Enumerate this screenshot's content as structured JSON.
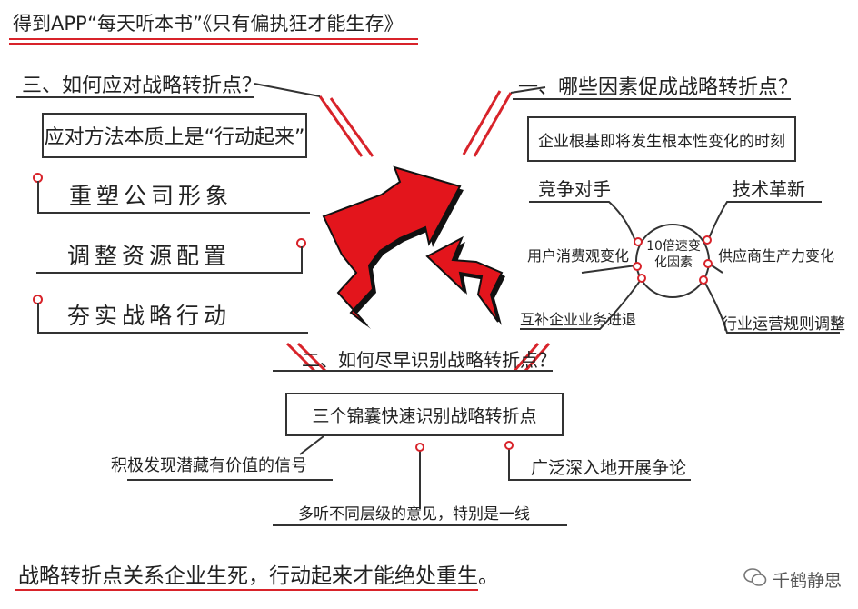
{
  "header": {
    "title": "得到APP“每天听本书”《只有偏执狂才能生存》"
  },
  "section3": {
    "title": "三、如何应对战略转折点？",
    "box": "应对方法本质上是“行动起来”",
    "items": [
      "重塑公司形象",
      "调整资源配置",
      "夯实战略行动"
    ]
  },
  "section1": {
    "title": "一、哪些因素促成战略转折点？",
    "box": "企业根基即将发生根本性变化的时刻",
    "center": "10倍速变化因素",
    "factors": [
      "竞争对手",
      "技术革新",
      "用户消费观变化",
      "供应商生产力变化",
      "互补企业业务进退",
      "行业运营规则调整"
    ]
  },
  "section2": {
    "title": "二、如何尽早识别战略转折点？",
    "box": "三个锦囊快速识别战略转折点",
    "items": [
      "积极发现潜藏有价值的信号",
      "广泛深入地开展争论",
      "多听不同层级的意见，特别是一线"
    ]
  },
  "footer": {
    "text": "战略转折点关系企业生死，行动起来才能绝处重生。"
  },
  "watermark": {
    "text": "千鹤静思"
  },
  "colors": {
    "accent": "#d8232a",
    "ink": "#222222"
  }
}
